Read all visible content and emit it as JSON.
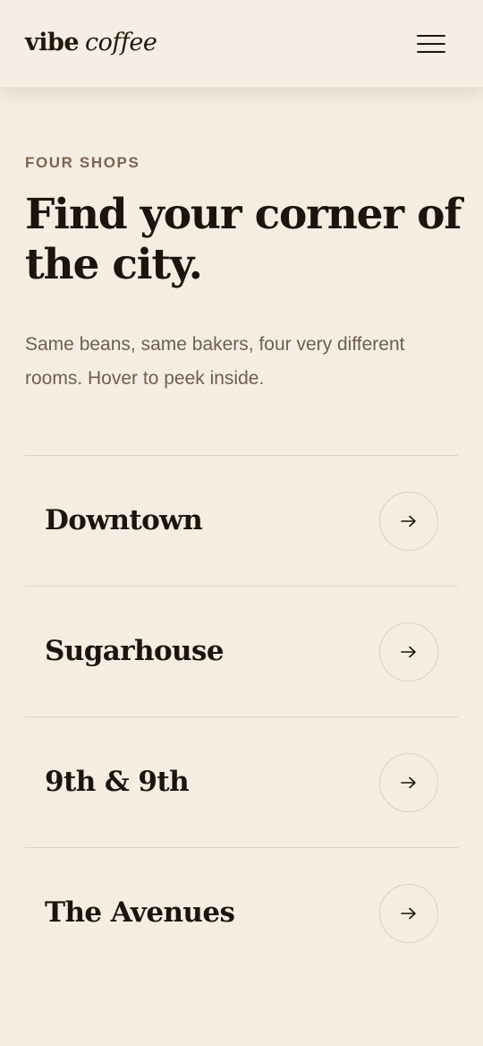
{
  "header": {
    "logo_word1": "vibe",
    "logo_word2": "coffee",
    "menu_icon": "hamburger-menu-icon"
  },
  "hero": {
    "eyebrow": "FOUR SHOPS",
    "title": "Find your corner of the city.",
    "intro": "Same beans, same bakers, four very different rooms. Hover to peek inside."
  },
  "shops": [
    {
      "name": "Downtown",
      "icon": "arrow-right-icon"
    },
    {
      "name": "Sugarhouse",
      "icon": "arrow-right-icon"
    },
    {
      "name": "9th & 9th",
      "icon": "arrow-right-icon"
    },
    {
      "name": "The Avenues",
      "icon": "arrow-right-icon"
    }
  ],
  "colors": {
    "background": "#f5ede2",
    "text_primary": "#1e140d",
    "text_muted": "#6f5e50",
    "eyebrow": "#7a6553",
    "divider": "#ddd0c0"
  }
}
